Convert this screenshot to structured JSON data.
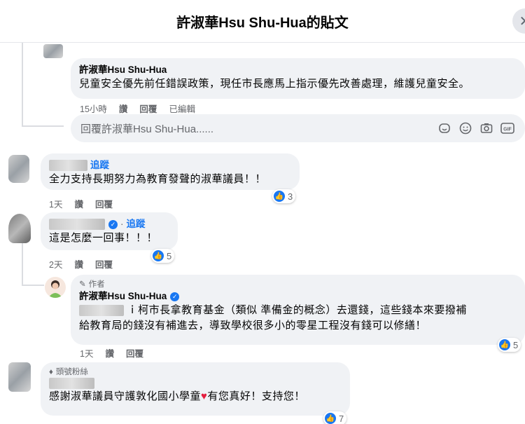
{
  "header": {
    "title": "許淑華Hsu Shu-Hua的貼文"
  },
  "comments": [
    {
      "name": "許淑華Hsu Shu-Hua",
      "text": "兒童安全優先前任錯誤政策，現任市長應馬上指示優先改善處理，維護兒童安全。",
      "time": "15小時",
      "like": "讚",
      "reply": "回覆",
      "edited": "已編輯"
    },
    {
      "follow": "追蹤",
      "text": "全力支持長期努力為教育發聲的淑華議員！！",
      "time": "1天",
      "like": "讚",
      "reply": "回覆",
      "reactions": "3"
    },
    {
      "follow": "追蹤",
      "text": "這是怎麼一回事！！！",
      "time": "2天",
      "like": "讚",
      "reply": "回覆",
      "reactions": "5"
    },
    {
      "author_label": "作者",
      "name": "許淑華Hsu Shu-Hua",
      "mention_suffix": "ｉ柯市長拿教育基金（類似 準備金的概念）去還錢，這些錢本來要撥補",
      "text_line2": "給教育局的錢沒有補進去，導致學校很多小的零星工程沒有錢可以修繕！",
      "time": "1天",
      "like": "讚",
      "reply": "回覆",
      "reactions": "5"
    },
    {
      "badge": "頭號粉絲",
      "text_a": "感謝淑華議員守護敦化國小學童",
      "text_b": "有您真好！支持您！",
      "reactions": "7"
    }
  ],
  "reply_box": {
    "placeholder": "回覆許淑華Hsu Shu-Hua......"
  },
  "colors": {
    "accent": "#1877f2",
    "bubble": "#f0f2f5",
    "meta": "#65676b"
  }
}
